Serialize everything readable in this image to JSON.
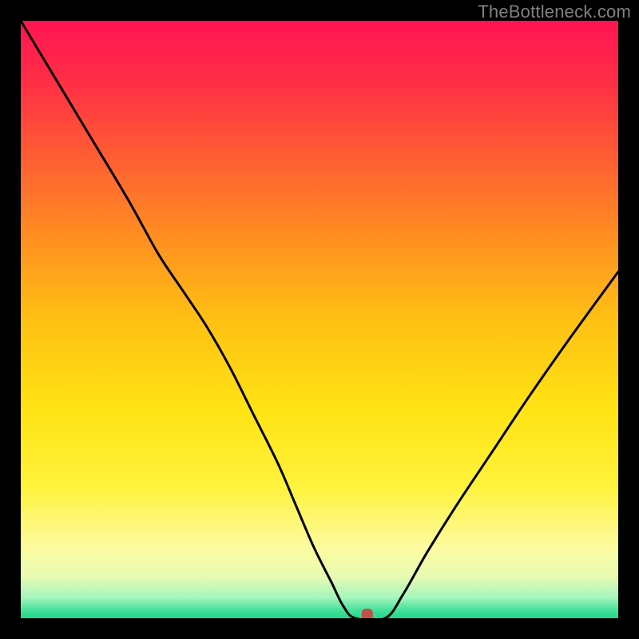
{
  "watermark": "TheBottleneck.com",
  "colors": {
    "frame": "#000000",
    "curve": "#000000",
    "marker": "#c0504e",
    "gradient_stops": [
      {
        "offset": 0.0,
        "color": "#ff1452"
      },
      {
        "offset": 0.1,
        "color": "#ff2e46"
      },
      {
        "offset": 0.22,
        "color": "#ff5a34"
      },
      {
        "offset": 0.35,
        "color": "#ff8a22"
      },
      {
        "offset": 0.5,
        "color": "#ffc014"
      },
      {
        "offset": 0.65,
        "color": "#ffe314"
      },
      {
        "offset": 0.78,
        "color": "#fff23c"
      },
      {
        "offset": 0.88,
        "color": "#fdfb9e"
      },
      {
        "offset": 0.93,
        "color": "#e8fbb2"
      },
      {
        "offset": 0.965,
        "color": "#a6f6bc"
      },
      {
        "offset": 0.985,
        "color": "#4be29d"
      },
      {
        "offset": 1.0,
        "color": "#1fd789"
      }
    ]
  },
  "chart_data": {
    "type": "line",
    "title": "",
    "xlabel": "",
    "ylabel": "",
    "xlim": [
      0,
      100
    ],
    "ylim": [
      0,
      100
    ],
    "x": [
      0,
      6,
      12,
      18,
      23,
      27,
      31,
      35,
      39,
      43,
      46,
      49,
      52,
      54,
      56,
      61,
      64,
      68,
      73,
      79,
      85,
      92,
      100
    ],
    "values": [
      100,
      90,
      80,
      70,
      61,
      55,
      49,
      42,
      34,
      26,
      19,
      12,
      6,
      2,
      0,
      0,
      4,
      11,
      19,
      28,
      37,
      47,
      58
    ],
    "marker": {
      "x": 58,
      "y": 0
    },
    "notes": "Y axis is inverted visually (0 at bottom = green band, 100 at top). Values are bottleneck percentage; minimum band spans roughly x=54..61."
  }
}
